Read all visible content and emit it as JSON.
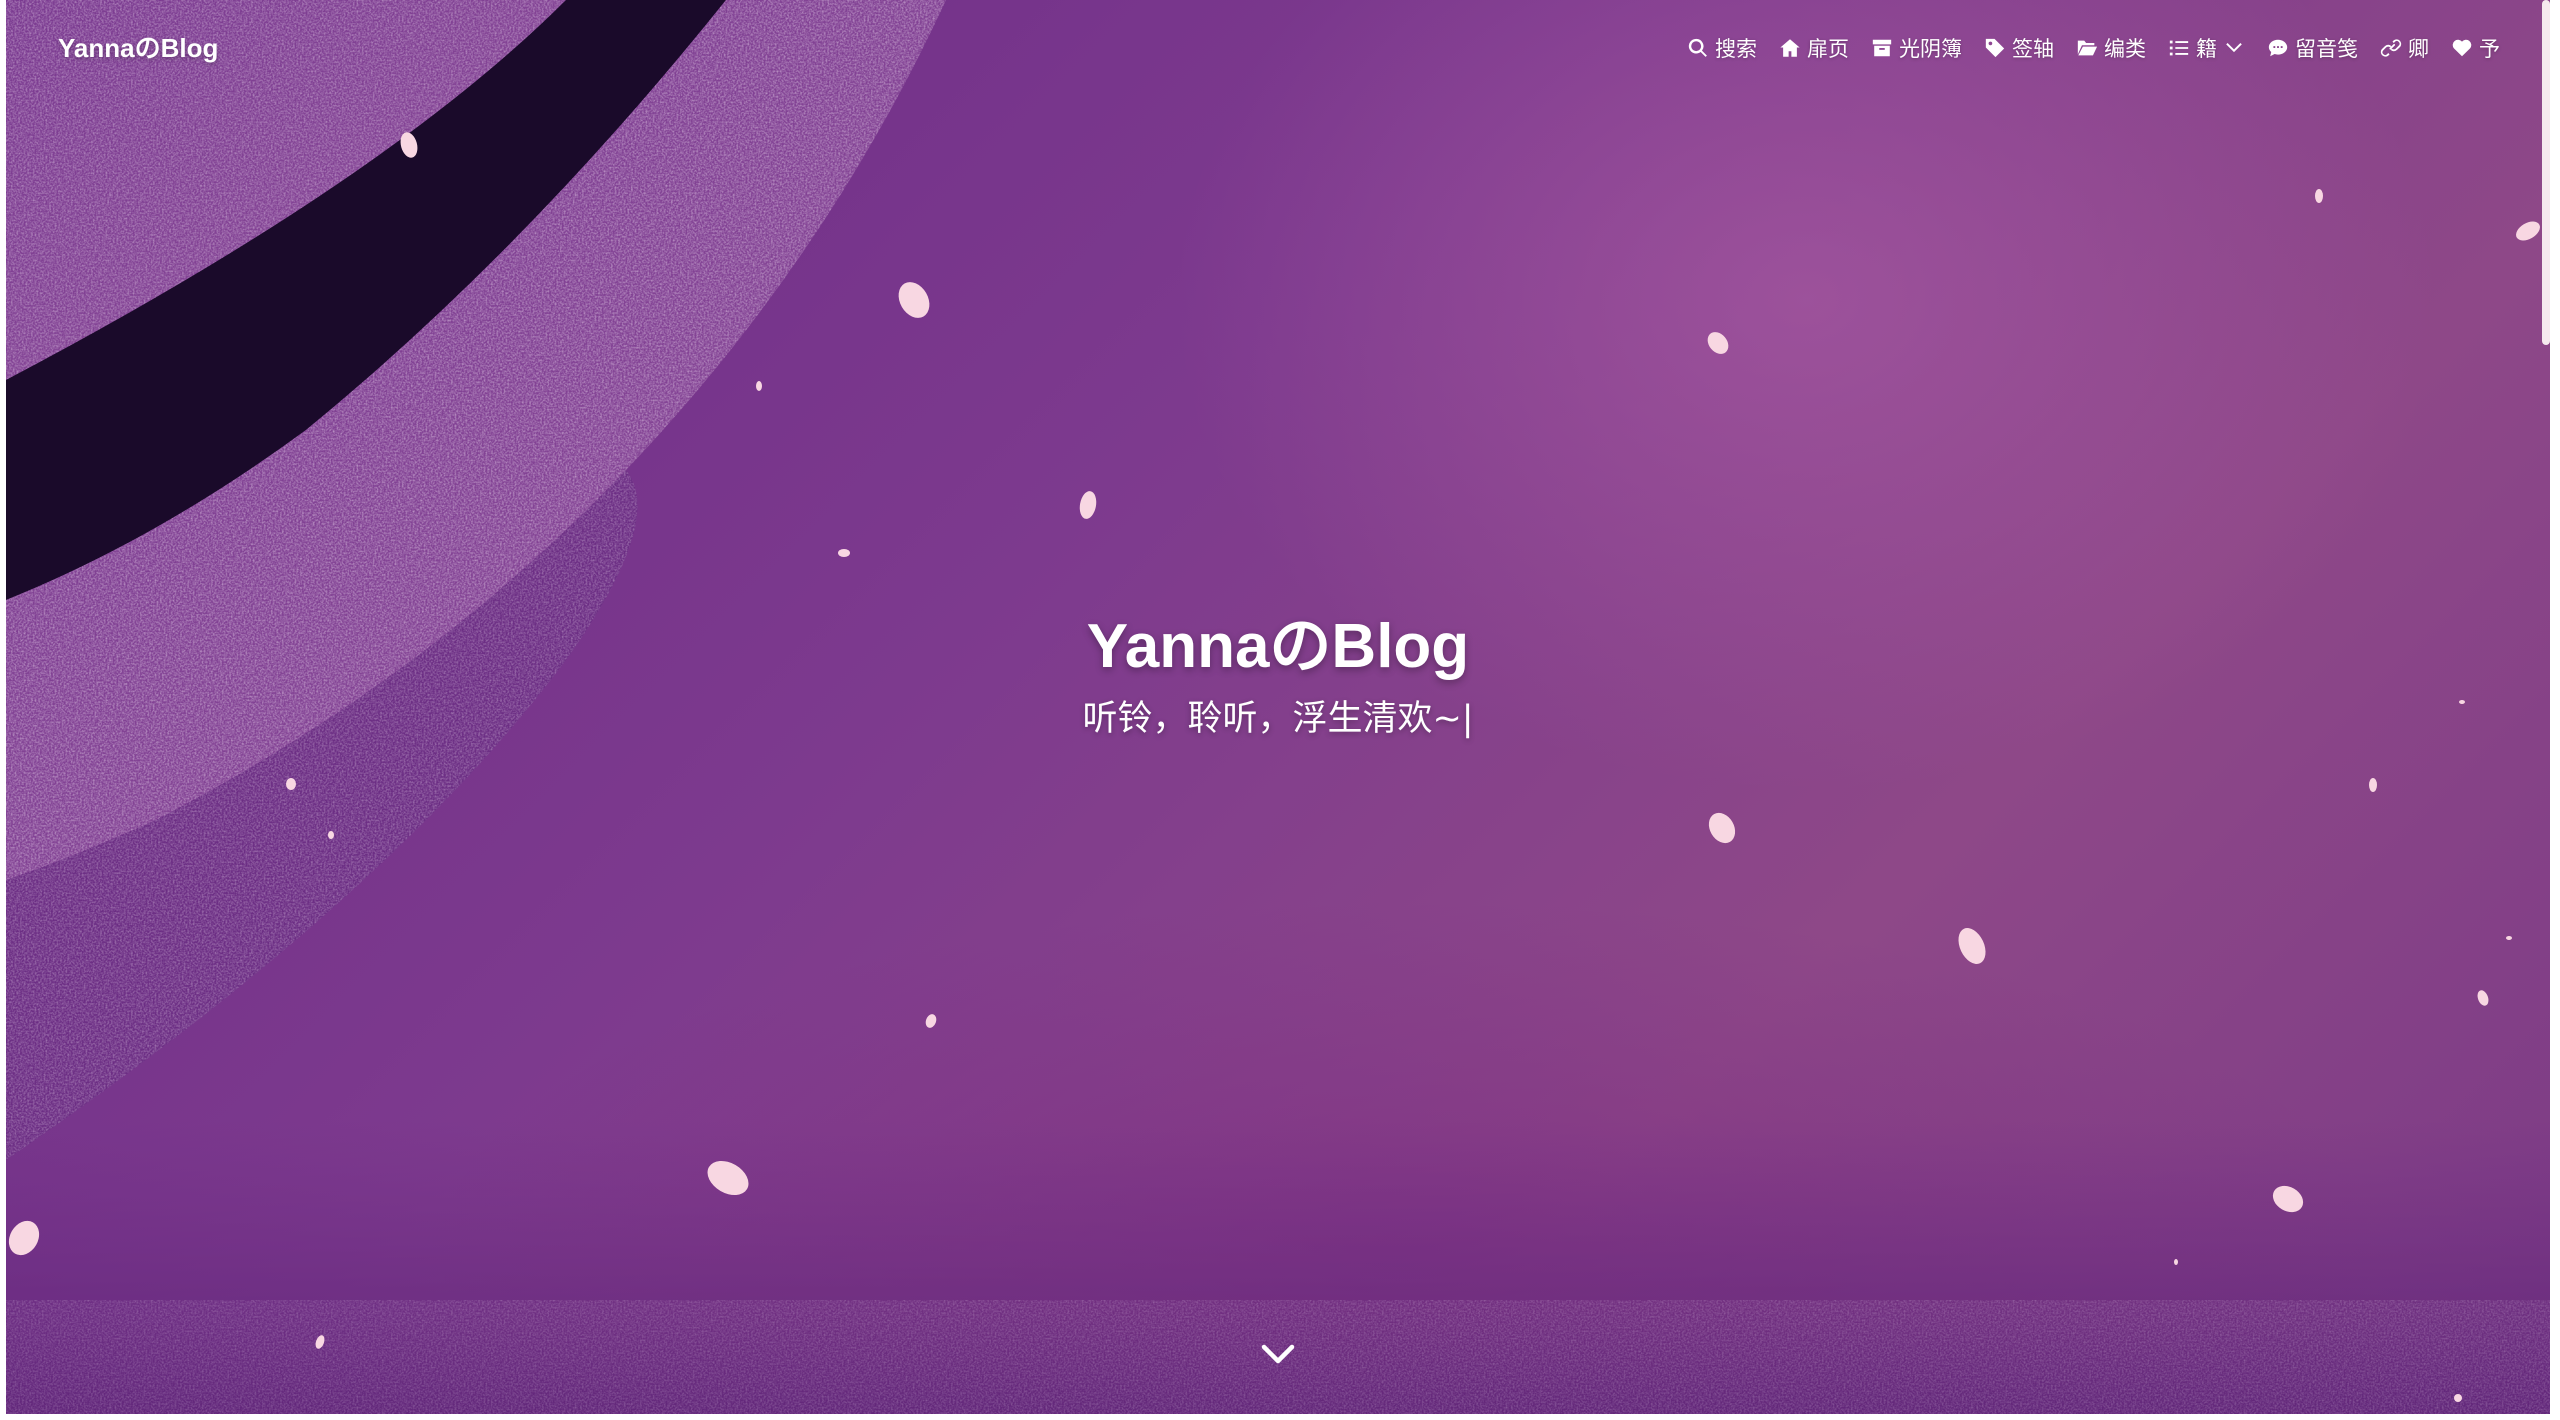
{
  "brand": {
    "label": "YannaのBlog"
  },
  "nav": {
    "items": [
      {
        "label": "搜索",
        "icon": "search-icon"
      },
      {
        "label": "扉页",
        "icon": "home-icon"
      },
      {
        "label": "光阴簿",
        "icon": "archive-icon"
      },
      {
        "label": "签轴",
        "icon": "tag-icon"
      },
      {
        "label": "编类",
        "icon": "folder-open-icon"
      },
      {
        "label": "籍",
        "icon": "list-icon",
        "dropdown": true
      },
      {
        "label": "留音笺",
        "icon": "comment-icon"
      },
      {
        "label": "卿",
        "icon": "link-icon"
      },
      {
        "label": "予",
        "icon": "heart-icon"
      }
    ]
  },
  "hero": {
    "title": "YannaのBlog",
    "subtitle": "听铃，聆听，浮生清欢~|"
  },
  "theme": {
    "background": "#7b3a8c",
    "text": "#ffffff",
    "petal": "#f8d7e2"
  }
}
